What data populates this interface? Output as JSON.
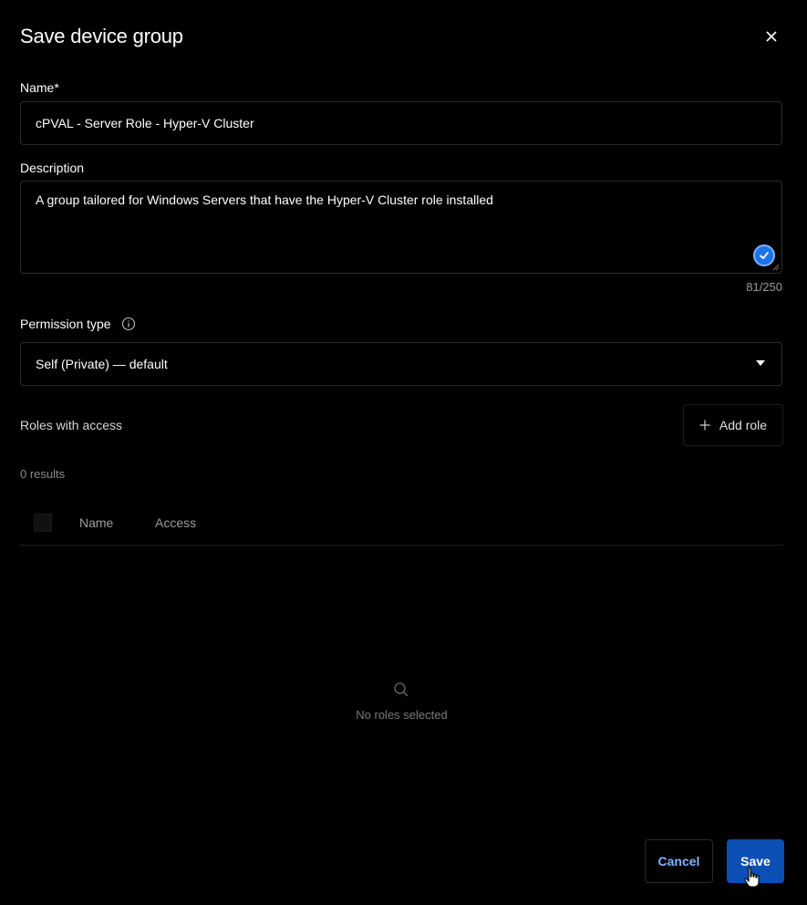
{
  "dialog": {
    "title": "Save device group",
    "close_icon": "close-icon"
  },
  "name": {
    "label": "Name*",
    "value": "cPVAL - Server Role - Hyper-V Cluster"
  },
  "description": {
    "label": "Description",
    "value": "A group tailored for Windows Servers that have the Hyper-V Cluster role installed",
    "counter": "81/250",
    "badge_icon": "check-circle-icon"
  },
  "permission": {
    "label": "Permission type",
    "info_icon": "info-icon",
    "selected": "Self (Private) — default"
  },
  "roles": {
    "label": "Roles with access",
    "add_button": "Add role",
    "add_icon": "plus-icon",
    "results": "0 results",
    "columns": [
      "Name",
      "Access"
    ],
    "empty_text": "No roles selected",
    "empty_icon": "search-icon"
  },
  "footer": {
    "cancel": "Cancel",
    "save": "Save"
  },
  "colors": {
    "background": "#000000",
    "primary": "#0c4fb5",
    "link": "#7fb6ff",
    "border": "#2b2b2b"
  }
}
